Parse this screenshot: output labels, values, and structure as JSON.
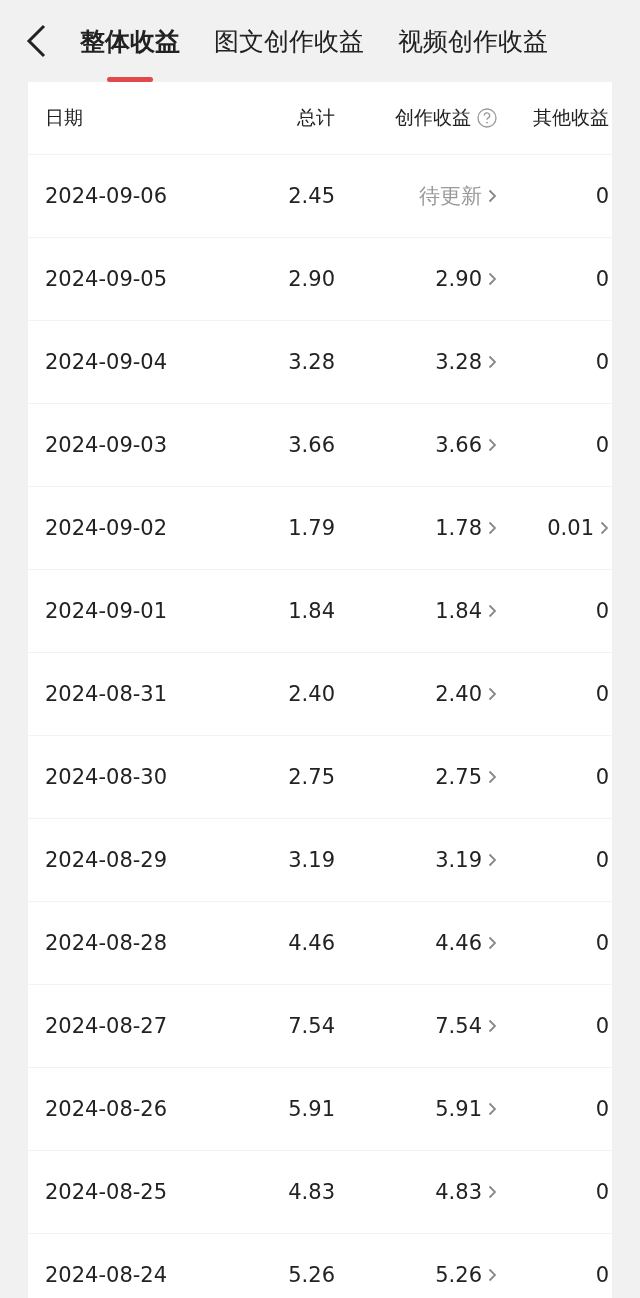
{
  "tabs": [
    {
      "label": "整体收益",
      "selected": true
    },
    {
      "label": "图文创作收益",
      "selected": false
    },
    {
      "label": "视频创作收益",
      "selected": false
    }
  ],
  "table": {
    "columns": [
      {
        "label": "日期",
        "help": false
      },
      {
        "label": "总计",
        "help": false
      },
      {
        "label": "创作收益",
        "help": true
      },
      {
        "label": "其他收益",
        "help": false
      }
    ],
    "rows": [
      {
        "date": "2024-09-06",
        "total": "2.45",
        "creative": "待更新",
        "creative_pending": true,
        "creative_link": true,
        "other": "0",
        "other_link": false
      },
      {
        "date": "2024-09-05",
        "total": "2.90",
        "creative": "2.90",
        "creative_pending": false,
        "creative_link": true,
        "other": "0",
        "other_link": false
      },
      {
        "date": "2024-09-04",
        "total": "3.28",
        "creative": "3.28",
        "creative_pending": false,
        "creative_link": true,
        "other": "0",
        "other_link": false
      },
      {
        "date": "2024-09-03",
        "total": "3.66",
        "creative": "3.66",
        "creative_pending": false,
        "creative_link": true,
        "other": "0",
        "other_link": false
      },
      {
        "date": "2024-09-02",
        "total": "1.79",
        "creative": "1.78",
        "creative_pending": false,
        "creative_link": true,
        "other": "0.01",
        "other_link": true
      },
      {
        "date": "2024-09-01",
        "total": "1.84",
        "creative": "1.84",
        "creative_pending": false,
        "creative_link": true,
        "other": "0",
        "other_link": false
      },
      {
        "date": "2024-08-31",
        "total": "2.40",
        "creative": "2.40",
        "creative_pending": false,
        "creative_link": true,
        "other": "0",
        "other_link": false
      },
      {
        "date": "2024-08-30",
        "total": "2.75",
        "creative": "2.75",
        "creative_pending": false,
        "creative_link": true,
        "other": "0",
        "other_link": false
      },
      {
        "date": "2024-08-29",
        "total": "3.19",
        "creative": "3.19",
        "creative_pending": false,
        "creative_link": true,
        "other": "0",
        "other_link": false
      },
      {
        "date": "2024-08-28",
        "total": "4.46",
        "creative": "4.46",
        "creative_pending": false,
        "creative_link": true,
        "other": "0",
        "other_link": false
      },
      {
        "date": "2024-08-27",
        "total": "7.54",
        "creative": "7.54",
        "creative_pending": false,
        "creative_link": true,
        "other": "0",
        "other_link": false
      },
      {
        "date": "2024-08-26",
        "total": "5.91",
        "creative": "5.91",
        "creative_pending": false,
        "creative_link": true,
        "other": "0",
        "other_link": false
      },
      {
        "date": "2024-08-25",
        "total": "4.83",
        "creative": "4.83",
        "creative_pending": false,
        "creative_link": true,
        "other": "0",
        "other_link": false
      },
      {
        "date": "2024-08-24",
        "total": "5.26",
        "creative": "5.26",
        "creative_pending": false,
        "creative_link": true,
        "other": "0",
        "other_link": false
      }
    ]
  }
}
